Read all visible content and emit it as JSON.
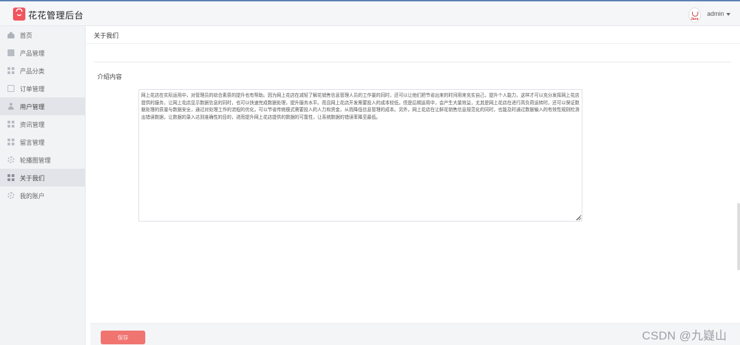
{
  "app": {
    "brand": "花花管理后台",
    "logo_icon": "shopping-bag-icon",
    "brand_color": "#f0555e"
  },
  "header": {
    "user_name": "admin",
    "avatar_icon": "java-logo-icon",
    "avatar_text": "Java"
  },
  "sidebar": {
    "items": [
      {
        "label": "首页",
        "icon": "home-icon",
        "active": false
      },
      {
        "label": "产品管理",
        "icon": "box-icon",
        "active": false
      },
      {
        "label": "产品分类",
        "icon": "grid-icon",
        "active": false
      },
      {
        "label": "订单管理",
        "icon": "clipboard-icon",
        "active": false
      },
      {
        "label": "用户管理",
        "icon": "person-icon",
        "active": true
      },
      {
        "label": "资讯管理",
        "icon": "grid-icon",
        "active": false
      },
      {
        "label": "留言管理",
        "icon": "grid-icon",
        "active": false
      },
      {
        "label": "轮播图管理",
        "icon": "gear-icon",
        "active": false
      },
      {
        "label": "关于我们",
        "icon": "grid-icon",
        "active": true
      },
      {
        "label": "我的账户",
        "icon": "gear-icon",
        "active": false
      }
    ]
  },
  "main": {
    "breadcrumb": "关于我们",
    "field_label": "介绍内容",
    "content_text": "网上花店在实际运用中，对管理员的综合素质的提升也有帮助。因为网上花店在减轻了解花销售信息管理人员的工作量的同时，还可以让他们把节省出来的时间用来充实自己，提升个人能力，这样才可以充分发挥网上花店提供的服务，让网上花店显示数据信息的同时，也可以快速完成数据处理，提升服务水平。而且网上花店开发需要投入的成本较低，但是后期运用中，会产生大量效益，尤其是网上花店在进行高负荷运转时，还可以保证数据处理的质量与数据安全，通过对处理工作的流程的优化，可以节省传统模式需要投入的人力和资金，从而降低信息管理的成本。另外，网上花店在让鲜花销售信息规范化的同时，也能及时通过数据输入的有效性规则检测出错误数据，让数据的录入达到准确性的目的，进而提升网上花店提供的数据的可靠性，让系统数据的错误率降至最低。",
    "save_label": "保存",
    "save_color": "#f07470"
  },
  "watermark": "CSDN @九嶷山"
}
